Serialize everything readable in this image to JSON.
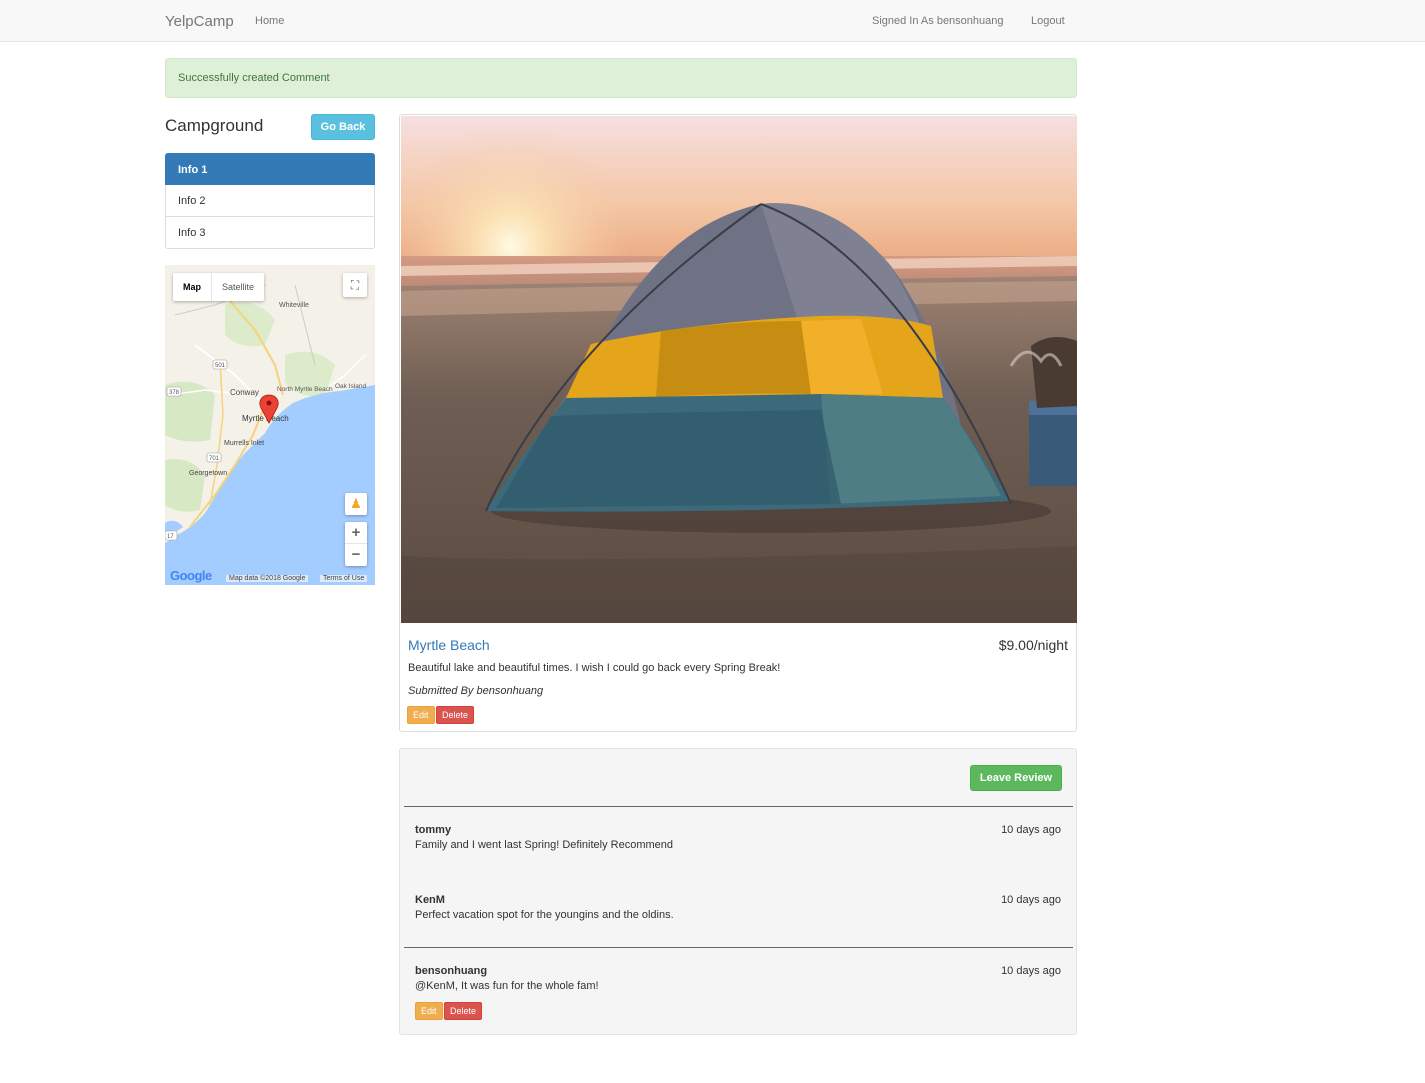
{
  "navbar": {
    "brand": "YelpCamp",
    "home": "Home",
    "signed_in": "Signed In As bensonhuang",
    "logout": "Logout"
  },
  "alert": {
    "message": "Successfully created Comment"
  },
  "sidebar": {
    "title": "Campground",
    "go_back": "Go Back",
    "items": [
      {
        "label": "Info 1",
        "active": true
      },
      {
        "label": "Info 2",
        "active": false
      },
      {
        "label": "Info 3",
        "active": false
      }
    ]
  },
  "map": {
    "tabs": [
      "Map",
      "Satellite"
    ],
    "selected_tab": "Map",
    "places": [
      "Whiteville",
      "Conway",
      "North Myrtle Beach",
      "Oak Island",
      "Myrtle Beach",
      "Murrells Inlet",
      "Georgetown"
    ],
    "road_shields": [
      "501",
      "378",
      "701",
      "17"
    ],
    "logo": "Google",
    "attribution": "Map data ©2018 Google",
    "terms": "Terms of Use",
    "zoom_in": "+",
    "zoom_out": "−"
  },
  "campground": {
    "name": "Myrtle Beach",
    "price": "$9.00/night",
    "description": "Beautiful lake and beautiful times. I wish I could go back every Spring Break!",
    "submitted_by": "Submitted By bensonhuang",
    "edit": "Edit",
    "delete": "Delete"
  },
  "reviews": {
    "leave_review": "Leave Review",
    "comments": [
      {
        "author": "tommy",
        "time": "10 days ago",
        "text": "Family and I went last Spring! Definitely Recommend"
      },
      {
        "author": "KenM",
        "time": "10 days ago",
        "text": "Perfect vacation spot for the youngins and the oldins."
      },
      {
        "author": "bensonhuang",
        "time": "10 days ago",
        "text": "@KenM, It was fun for the whole fam!",
        "edit": "Edit",
        "delete": "Delete"
      }
    ]
  },
  "colors": {
    "primary": "#337ab7",
    "info": "#5bc0de",
    "success": "#5cb85c",
    "warning": "#f0ad4e",
    "danger": "#d9534f",
    "alert_bg": "#dff0d8"
  },
  "icons": {
    "fullscreen": "fullscreen-icon",
    "pegman": "pegman-icon",
    "marker": "map-marker-icon"
  }
}
